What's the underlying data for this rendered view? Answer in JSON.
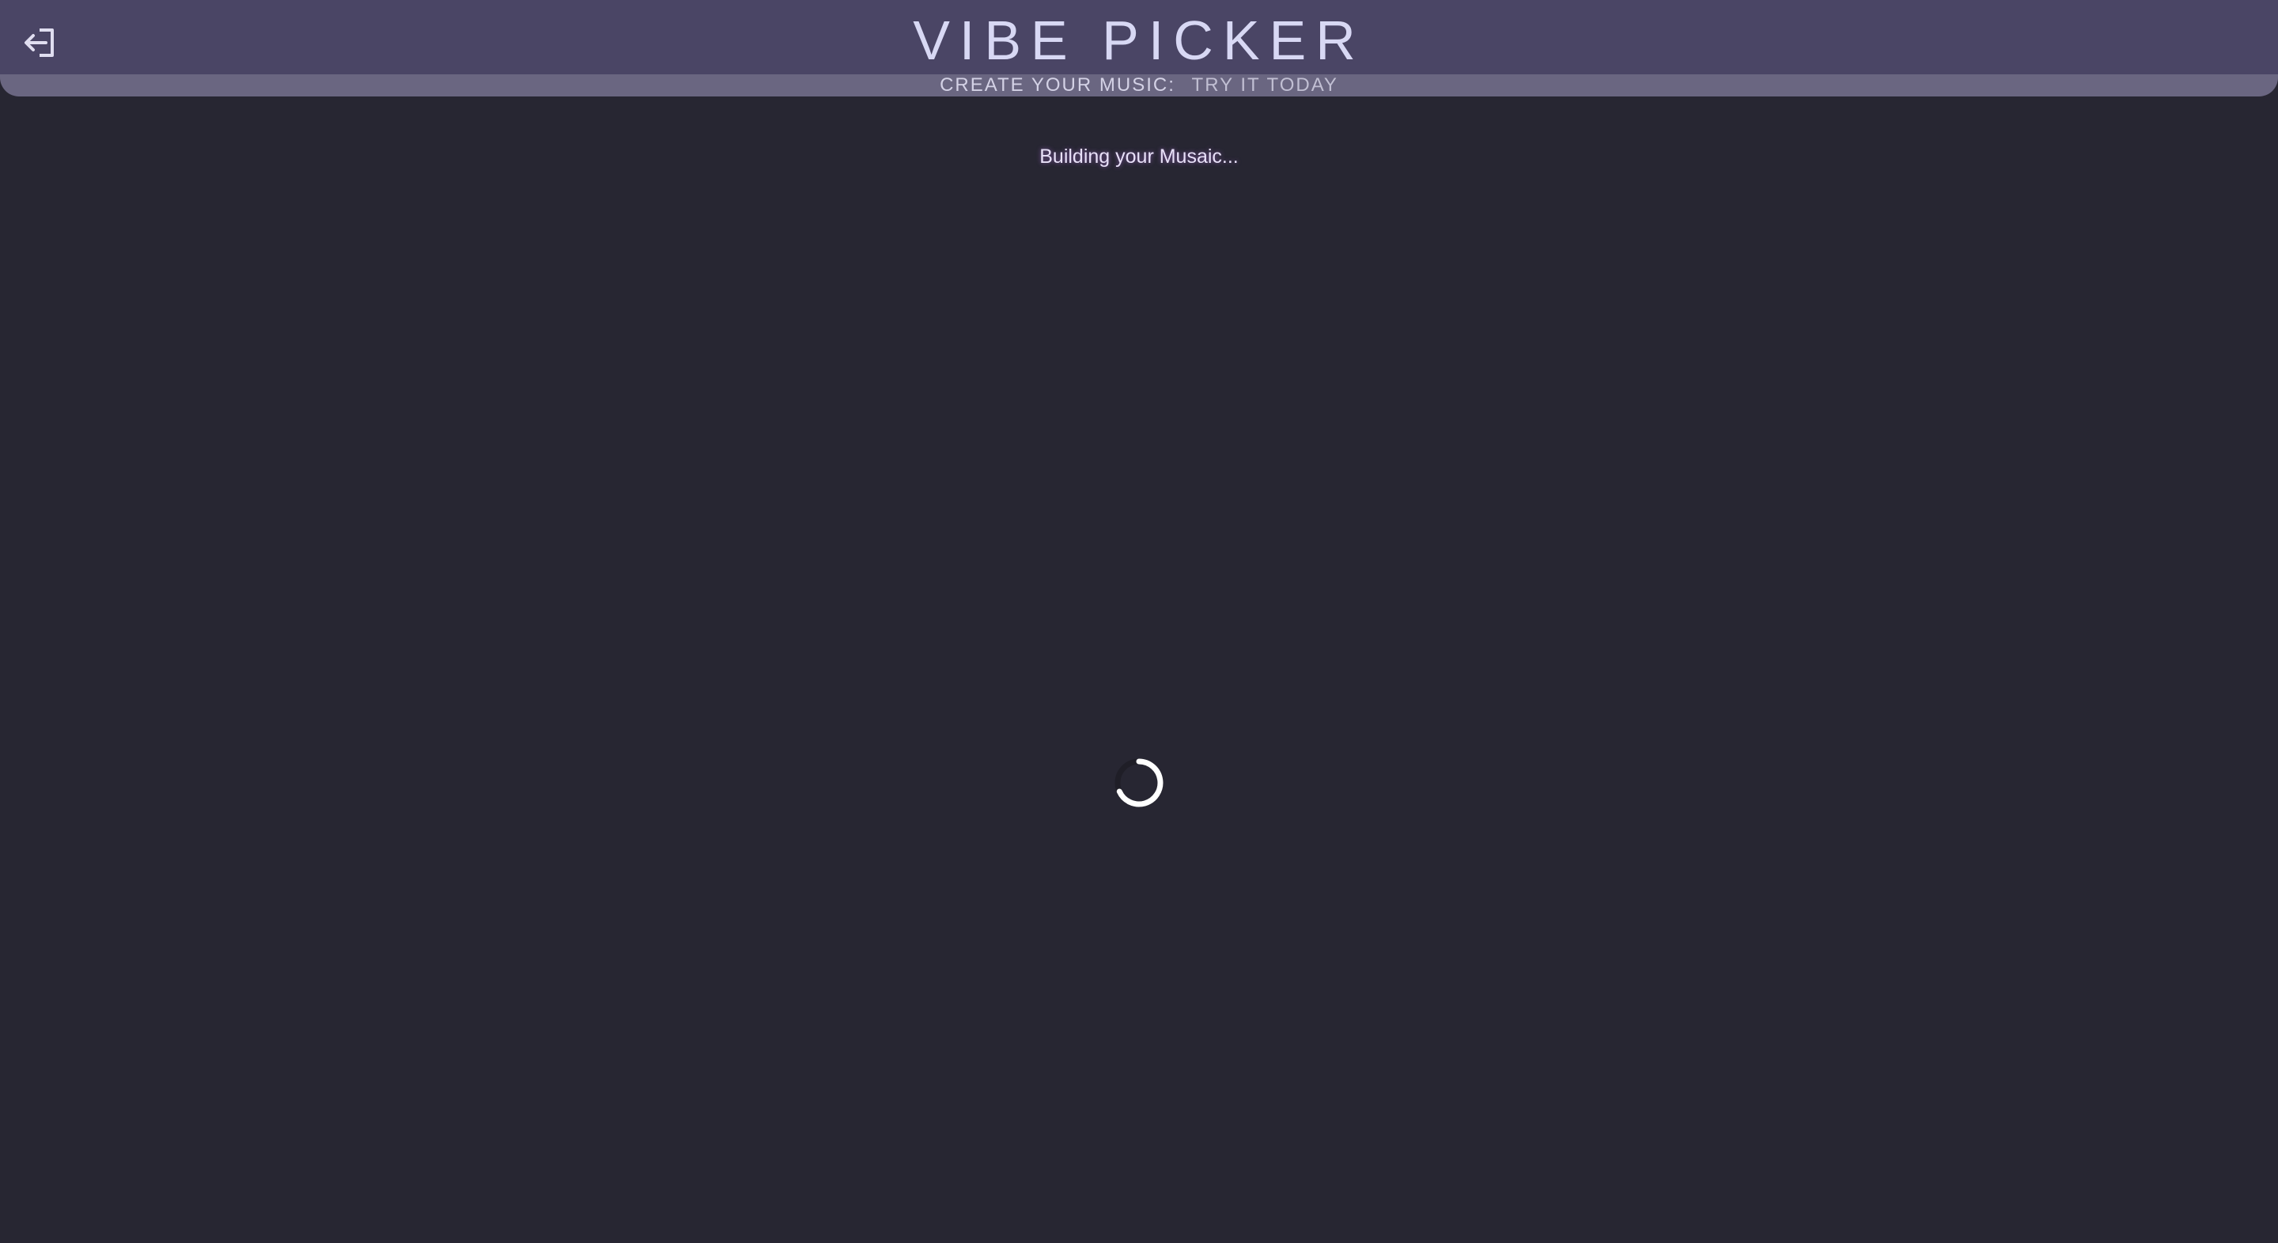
{
  "header": {
    "title": "VIBE PICKER",
    "tagline_strong": "CREATE YOUR MUSIC:",
    "tagline_light": "TRY IT TODAY",
    "logout_icon": "logout-arrow-icon"
  },
  "main": {
    "status_text": "Building your Musaic...",
    "spinner_icon": "loading-spinner-icon"
  },
  "colors": {
    "background": "#272632",
    "header": "#4a4565",
    "subbar": "#6a6681",
    "title_text": "#d8d8f4",
    "status_glow": "#c882ff"
  }
}
